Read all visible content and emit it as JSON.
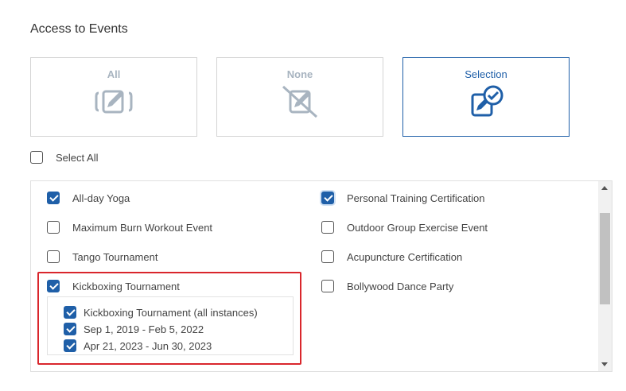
{
  "section": {
    "title": "Access to Events"
  },
  "modes": [
    {
      "label": "All",
      "selected": false
    },
    {
      "label": "None",
      "selected": false
    },
    {
      "label": "Selection",
      "selected": true
    }
  ],
  "select_all": {
    "label": "Select All",
    "checked": false
  },
  "events_left": [
    {
      "label": "All-day Yoga",
      "checked": true
    },
    {
      "label": "Maximum Burn Workout Event",
      "checked": false
    },
    {
      "label": "Tango Tournament",
      "checked": false
    },
    {
      "label": "Kickboxing Tournament",
      "checked": true
    }
  ],
  "events_right": [
    {
      "label": "Personal Training Certification",
      "checked": true
    },
    {
      "label": "Outdoor Group Exercise Event",
      "checked": false
    },
    {
      "label": "Acupuncture Certification",
      "checked": false
    },
    {
      "label": "Bollywood Dance Party",
      "checked": false
    }
  ],
  "kickboxing_instances": [
    {
      "label": "Kickboxing Tournament (all instances)",
      "checked": true
    },
    {
      "label": "Sep 1, 2019 - Feb 5, 2022",
      "checked": true
    },
    {
      "label": "Apr 21, 2023 - Jun 30, 2023",
      "checked": true
    }
  ],
  "colors": {
    "accent": "#1f5fa8",
    "highlight": "#d9262c",
    "disabled": "#a8b4c0"
  },
  "icons": {
    "all": "edit-multiple-icon",
    "none": "edit-disabled-icon",
    "selection": "edit-check-icon"
  }
}
